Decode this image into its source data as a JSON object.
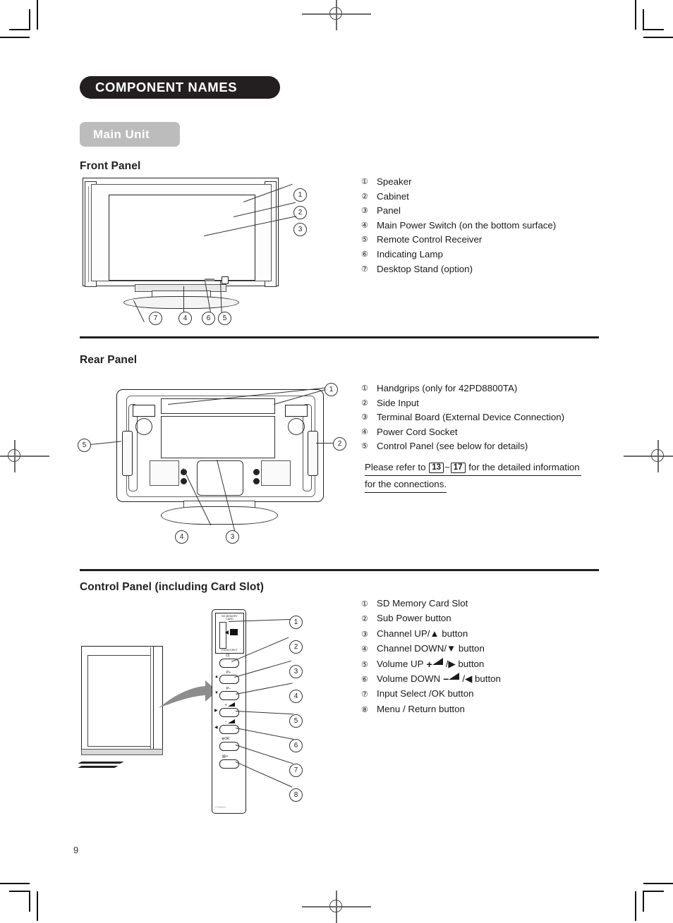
{
  "document": {
    "chapter_heading": "COMPONENT NAMES",
    "section_tag": "Main Unit",
    "page_number": "9"
  },
  "front_panel": {
    "title": "Front Panel",
    "callouts": [
      "1",
      "2",
      "3",
      "4",
      "5",
      "6",
      "7"
    ],
    "legend": [
      {
        "num": "①",
        "label": "Speaker"
      },
      {
        "num": "②",
        "label": "Cabinet"
      },
      {
        "num": "③",
        "label": "Panel"
      },
      {
        "num": "④",
        "label": "Main Power Switch (on the bottom surface)"
      },
      {
        "num": "⑤",
        "label": "Remote Control Receiver"
      },
      {
        "num": "⑥",
        "label": "Indicating Lamp"
      },
      {
        "num": "⑦",
        "label": "Desktop Stand (option)"
      }
    ]
  },
  "rear_panel": {
    "title": "Rear Panel",
    "callouts": [
      "1",
      "2",
      "3",
      "4",
      "5"
    ],
    "legend": [
      {
        "num": "①",
        "label": "Handgrips (only for 42PD8800TA)"
      },
      {
        "num": "②",
        "label": "Side Input"
      },
      {
        "num": "③",
        "label": "Terminal Board (External Device Connection)"
      },
      {
        "num": "④",
        "label": "Power Cord Socket"
      },
      {
        "num": "⑤",
        "label": "Control Panel (see below for details)"
      }
    ],
    "reference_note": {
      "lead": "Please refer to",
      "page_from": "13",
      "tilde": "~",
      "page_to": "17",
      "tail": "for the detailed information",
      "line2": "for the connections."
    }
  },
  "control_panel": {
    "title": "Control Panel (including Card Slot)",
    "callouts": [
      "1",
      "2",
      "3",
      "4",
      "5",
      "6",
      "7",
      "8"
    ],
    "legend": [
      {
        "num": "①",
        "label": "SD Memory Card Slot"
      },
      {
        "num": "②",
        "label": "Sub Power button"
      },
      {
        "num": "③",
        "label": "Channel UP/▲ button"
      },
      {
        "num": "④",
        "label": "Channel DOWN/▼ button"
      },
      {
        "num": "⑤",
        "label_pre": "Volume UP",
        "sign": "+",
        "wedge": true,
        "label_post": "/▶ button"
      },
      {
        "num": "⑥",
        "label_pre": "Volume DOWN",
        "sign": "−",
        "wedge": true,
        "label_post": "/◀ button"
      },
      {
        "num": "⑦",
        "label": "Input Select /OK button"
      },
      {
        "num": "⑧",
        "label": "Menu / Return button"
      }
    ],
    "diagram": {
      "card_label_line1": "SD MEMORY",
      "card_label_line2": "CARD",
      "eject_label": "PUSH-EJECT",
      "part_code": "PH38A11",
      "buttons": [
        {
          "label": "⏻|",
          "dir": ""
        },
        {
          "label": "P+",
          "dir": "▲"
        },
        {
          "label": "P−",
          "dir": "▼"
        },
        {
          "label": "+",
          "dir": "▶"
        },
        {
          "label": "−",
          "dir": "◀"
        },
        {
          "label": "⊕OK",
          "dir": ""
        },
        {
          "label": "▤↵",
          "dir": ""
        }
      ]
    }
  }
}
